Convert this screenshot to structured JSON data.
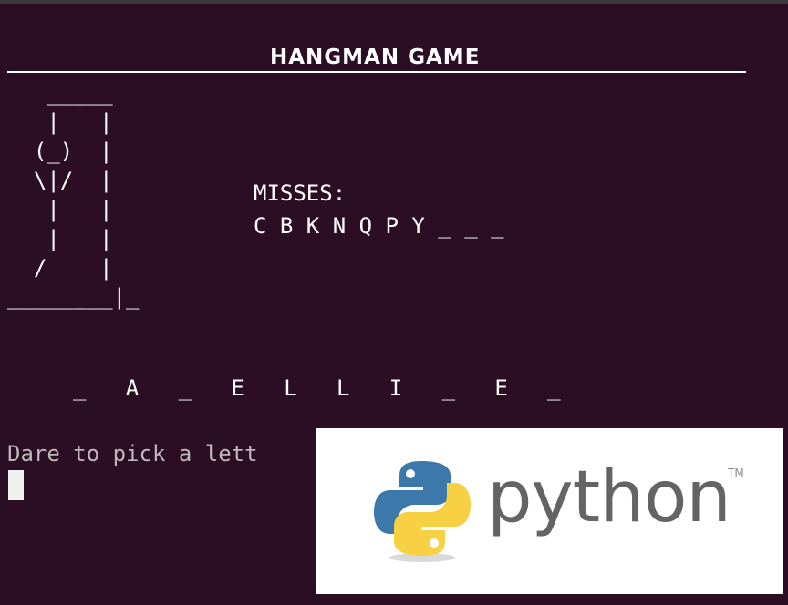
{
  "game": {
    "title": "HANGMAN GAME",
    "gallows_art": "   _____\n   |   |\n  (_)  |\n  \\|/  |\n   |   |\n   |   |\n  /    |\n________|_",
    "misses_label": "MISSES:",
    "misses_letters": "C B K N Q P Y _ _ _",
    "word_display": "_   A   _   E   L   L   I   _   E   _",
    "prompt_text": "Dare to pick a lett"
  },
  "badge": {
    "wordmark": "python",
    "trademark": "TM"
  },
  "colors": {
    "terminal_background": "#2b0d24",
    "text": "#ffffff",
    "prompt_text": "#bdb6bb",
    "python_blue": "#3c78aa",
    "python_yellow": "#f7d043"
  },
  "icons": {
    "logo": "python-snakes-logo",
    "cursor": "block-cursor"
  }
}
